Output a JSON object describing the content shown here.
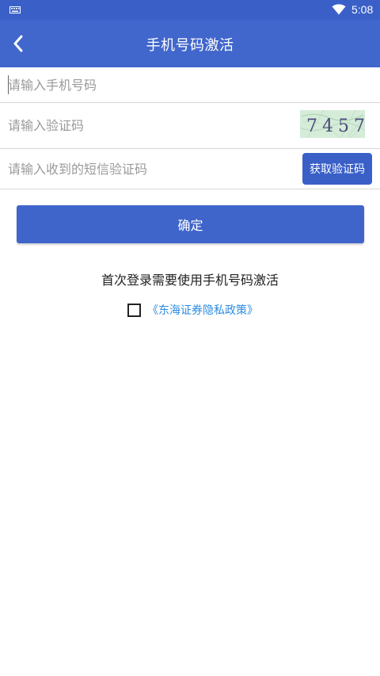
{
  "status_bar": {
    "time": "5:08",
    "icons": [
      "keyboard-icon",
      "wifi-icon"
    ]
  },
  "app_bar": {
    "title": "手机号码激活",
    "back_icon": "chevron-left-icon"
  },
  "form": {
    "phone_placeholder": "请输入手机号码",
    "captcha_placeholder": "请输入验证码",
    "captcha_text": "7457",
    "sms_placeholder": "请输入收到的短信验证码",
    "sms_button_label": "获取验证码"
  },
  "confirm_label": "确定",
  "notice": "首次登录需要使用手机号码激活",
  "policy": {
    "checked": false,
    "link_label": "《东海证券隐私政策》"
  },
  "colors": {
    "primary": "#4166cc",
    "status_bar": "#3a60c8",
    "link": "#2d8be0",
    "captcha_bg": "#d5ecd9"
  }
}
